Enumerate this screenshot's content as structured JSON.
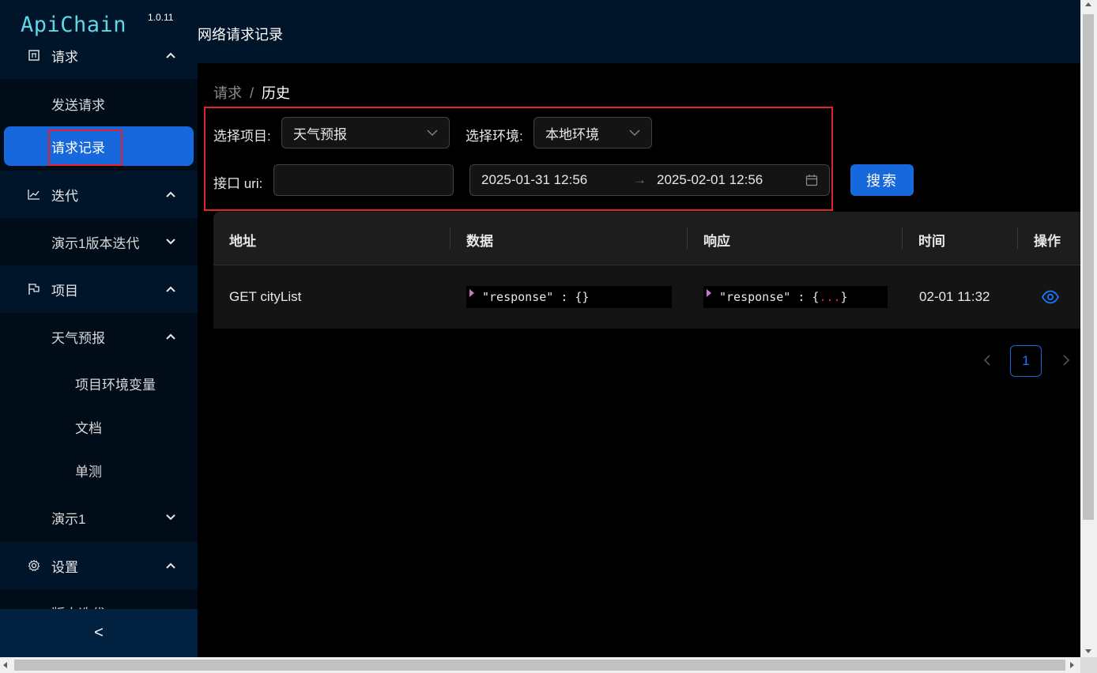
{
  "app": {
    "logo": "ApiChain",
    "version": "1.0.11"
  },
  "header": {
    "title": "网络请求记录"
  },
  "sidebar": {
    "groups": [
      {
        "label": "请求",
        "icon": "request-icon",
        "children": [
          "发送请求",
          "请求记录"
        ]
      },
      {
        "label": "迭代",
        "icon": "chart-line-icon",
        "children": [
          "演示1版本迭代"
        ]
      },
      {
        "label": "项目",
        "icon": "flag-icon",
        "children": [
          "天气预报",
          "项目环境变量",
          "文档",
          "单测",
          "演示1"
        ]
      },
      {
        "label": "设置",
        "icon": "gear-icon",
        "children": [
          "版本迭代"
        ]
      }
    ],
    "active_item": "请求记录",
    "collapse_label": "<"
  },
  "breadcrumb": {
    "parent": "请求",
    "separator": "/",
    "current": "历史"
  },
  "filters": {
    "project_label": "选择项目:",
    "project_value": "天气预报",
    "env_label": "选择环境:",
    "env_value": "本地环境",
    "uri_label": "接口 uri:",
    "uri_value": "",
    "date_start": "2025-01-31 12:56",
    "date_separator": "→",
    "date_end": "2025-02-01 12:56",
    "search_label": "搜索"
  },
  "table": {
    "columns": [
      "地址",
      "数据",
      "响应",
      "时间",
      "操作"
    ],
    "rows": [
      {
        "address": "GET cityList",
        "data": "\"response\" : {}",
        "response_prefix": "\"response\" : {",
        "response_ellipsis": "...",
        "response_suffix": "}",
        "time": "02-01 11:32",
        "action_icon": "eye-icon"
      }
    ]
  },
  "pagination": {
    "current": "1"
  }
}
